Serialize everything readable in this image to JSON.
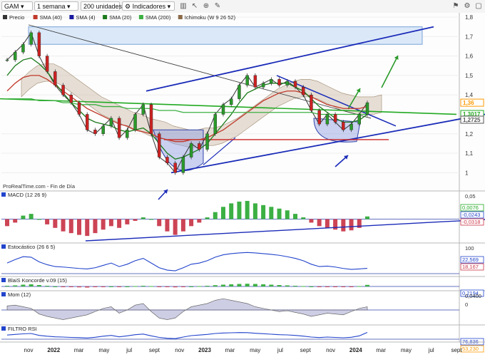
{
  "toolbar": {
    "symbol": "GAM",
    "period": "1 semana",
    "units": "200 unidades",
    "indicators": "Indicadores",
    "icons": [
      "chart-type-icon",
      "cursor-icon",
      "zoom-icon",
      "draw-icon",
      "alert-icon",
      "settings-icon",
      "window-icon"
    ]
  },
  "legend": {
    "items": [
      {
        "label": "Precio",
        "color": "#333333"
      },
      {
        "label": "SMA (40)",
        "color": "#c0392b"
      },
      {
        "label": "SMA (4)",
        "color": "#1a1aa0"
      },
      {
        "label": "SMA (20)",
        "color": "#1a7a1a"
      },
      {
        "label": "SMA (200)",
        "color": "#3cb043"
      },
      {
        "label": "Ichimoku (W 9 26 52)",
        "color": "#8b6b4a"
      }
    ]
  },
  "watermark": "ProRealTime.com - Fin de Día",
  "price_axis": {
    "ticks": [
      "1,8",
      "1,7",
      "1,6",
      "1,5",
      "1,4",
      "1,2",
      "1,1",
      "1"
    ],
    "badges": [
      {
        "text": "1,36",
        "color": "#ff9900"
      },
      {
        "text": "1,3017",
        "color": "#22aa22"
      },
      {
        "text": "1,2725",
        "color": "#555555"
      }
    ]
  },
  "time_axis": [
    "nov",
    "2022",
    "mar",
    "may",
    "jul",
    "sept",
    "nov",
    "2023",
    "mar",
    "may",
    "jul",
    "sept",
    "nov",
    "2024",
    "mar",
    "may",
    "jul",
    "sept"
  ],
  "panels": [
    {
      "title": "MACD (12 26 9)",
      "ticks": [
        "0,05"
      ],
      "values": [
        {
          "text": "0,0076",
          "color": "#22aa22"
        },
        {
          "text": "-0,0243",
          "color": "#2244cc"
        },
        {
          "text": "-0,0318",
          "color": "#cc3344"
        }
      ]
    },
    {
      "title": "Estocástico (26 6 5)",
      "ticks": [
        "100"
      ],
      "values": [
        {
          "text": "22,569",
          "color": "#2244cc"
        },
        {
          "text": "18,167",
          "color": "#cc3344"
        }
      ]
    },
    {
      "title": "BlaiS Koncorde v.09 (15)",
      "ticks": [],
      "values": [
        {
          "text": "0,2194",
          "color": "#2244cc"
        }
      ]
    },
    {
      "title": "Mom (12)",
      "ticks": [
        "0,0400",
        "0"
      ],
      "values": []
    },
    {
      "title": "FILTRO RSI",
      "ticks": [],
      "values": [
        {
          "text": "76,836",
          "color": "#2244cc"
        },
        {
          "text": "53,230",
          "color": "#ff9900"
        }
      ]
    }
  ],
  "chart_data": {
    "type": "line",
    "title": "GAM",
    "ylim": [
      0.95,
      1.8
    ],
    "series": [
      {
        "name": "Precio",
        "color": "#333333",
        "values": [
          1.58,
          1.62,
          1.66,
          1.72,
          1.6,
          1.52,
          1.45,
          1.4,
          1.36,
          1.3,
          1.22,
          1.2,
          1.24,
          1.28,
          1.18,
          1.22,
          1.3,
          1.35,
          1.2,
          1.08,
          1.05,
          1.0,
          1.08,
          1.15,
          1.12,
          1.2,
          1.3,
          1.35,
          1.38,
          1.45,
          1.5,
          1.44,
          1.46,
          1.48,
          1.45,
          1.47,
          1.44,
          1.4,
          1.32,
          1.25,
          1.3,
          1.26,
          1.22,
          1.25,
          1.3,
          1.36
        ]
      },
      {
        "name": "SMA (40)",
        "color": "#c0392b",
        "values": [
          1.42,
          1.46,
          1.49,
          1.5,
          1.5,
          1.48,
          1.45,
          1.42,
          1.39,
          1.36,
          1.33,
          1.31,
          1.29,
          1.27,
          1.25,
          1.24,
          1.22,
          1.21,
          1.2,
          1.18,
          1.17,
          1.16,
          1.16,
          1.17,
          1.17,
          1.18,
          1.2,
          1.22,
          1.25,
          1.28,
          1.31,
          1.34,
          1.37,
          1.39,
          1.41,
          1.42,
          1.42,
          1.41,
          1.39,
          1.37,
          1.35,
          1.34,
          1.33,
          1.33,
          1.33,
          1.34
        ]
      },
      {
        "name": "SMA (20)",
        "color": "#1a7a1a",
        "values": [
          1.5,
          1.55,
          1.58,
          1.59,
          1.56,
          1.52,
          1.46,
          1.41,
          1.36,
          1.32,
          1.28,
          1.26,
          1.25,
          1.24,
          1.22,
          1.21,
          1.22,
          1.23,
          1.2,
          1.15,
          1.1,
          1.07,
          1.08,
          1.1,
          1.12,
          1.15,
          1.2,
          1.25,
          1.3,
          1.36,
          1.41,
          1.43,
          1.45,
          1.46,
          1.46,
          1.46,
          1.44,
          1.42,
          1.38,
          1.34,
          1.31,
          1.28,
          1.26,
          1.26,
          1.27,
          1.3
        ]
      },
      {
        "name": "SMA (200)",
        "color": "#3cb043",
        "values": [
          1.38,
          1.38,
          1.38,
          1.38,
          1.37,
          1.37,
          1.37,
          1.36,
          1.36,
          1.35,
          1.35,
          1.35,
          1.34,
          1.34,
          1.34,
          1.33,
          1.33,
          1.33,
          1.33,
          1.32,
          1.32,
          1.32,
          1.31,
          1.31,
          1.31,
          1.31,
          1.31,
          1.31,
          1.31,
          1.31,
          1.31,
          1.31,
          1.31,
          1.31,
          1.31,
          1.31,
          1.31,
          1.31,
          1.31,
          1.3,
          1.3,
          1.3,
          1.3,
          1.3,
          1.3,
          1.3
        ]
      }
    ],
    "macd": [
      -0.02,
      -0.01,
      0.01,
      0.015,
      0.0,
      -0.015,
      -0.025,
      -0.035,
      -0.04,
      -0.045,
      -0.048,
      -0.04,
      -0.03,
      -0.02,
      -0.025,
      -0.015,
      -0.005,
      0.005,
      0.0,
      -0.02,
      -0.035,
      -0.045,
      -0.035,
      -0.02,
      -0.01,
      0.005,
      0.02,
      0.035,
      0.045,
      0.05,
      0.052,
      0.045,
      0.04,
      0.035,
      0.03,
      0.025,
      0.015,
      0.005,
      -0.01,
      -0.02,
      -0.025,
      -0.03,
      -0.035,
      -0.032,
      -0.025,
      0.0076
    ],
    "stochastic": [
      45,
      60,
      72,
      70,
      50,
      38,
      30,
      28,
      25,
      22,
      20,
      25,
      35,
      45,
      30,
      40,
      55,
      65,
      45,
      25,
      15,
      12,
      25,
      40,
      45,
      55,
      70,
      80,
      85,
      88,
      90,
      88,
      85,
      82,
      78,
      72,
      65,
      55,
      40,
      30,
      32,
      28,
      22,
      18,
      20,
      22.569
    ],
    "koncorde": [
      0.1,
      0.15,
      0.25,
      0.3,
      0.2,
      0.1,
      0.0,
      -0.05,
      -0.1,
      -0.12,
      -0.15,
      -0.1,
      -0.05,
      0.0,
      -0.05,
      0.0,
      0.05,
      0.1,
      0.05,
      -0.05,
      -0.1,
      -0.12,
      -0.05,
      0.0,
      0.05,
      0.1,
      0.18,
      0.25,
      0.3,
      0.35,
      0.38,
      0.35,
      0.3,
      0.25,
      0.2,
      0.15,
      0.1,
      0.05,
      0.0,
      -0.05,
      -0.08,
      -0.1,
      -0.08,
      -0.05,
      0.05,
      0.2194
    ],
    "momentum": [
      0.05,
      0.06,
      0.04,
      0.02,
      -0.05,
      -0.08,
      -0.1,
      -0.12,
      -0.1,
      -0.08,
      -0.06,
      -0.02,
      0.02,
      0.04,
      -0.04,
      0.0,
      0.06,
      0.08,
      -0.02,
      -0.1,
      -0.12,
      -0.1,
      -0.02,
      0.04,
      0.06,
      0.08,
      0.12,
      0.14,
      0.12,
      0.1,
      0.08,
      0.04,
      0.02,
      0.0,
      -0.02,
      -0.01,
      -0.03,
      -0.05,
      -0.08,
      -0.06,
      -0.04,
      -0.05,
      -0.06,
      -0.02,
      0.02,
      0.04
    ],
    "rsi": [
      55,
      60,
      65,
      68,
      52,
      45,
      40,
      38,
      35,
      33,
      30,
      36,
      45,
      52,
      40,
      48,
      58,
      63,
      48,
      35,
      28,
      25,
      38,
      50,
      55,
      60,
      68,
      72,
      74,
      76,
      75,
      70,
      66,
      62,
      58,
      56,
      52,
      46,
      38,
      34,
      38,
      35,
      32,
      36,
      48,
      76.836
    ]
  }
}
